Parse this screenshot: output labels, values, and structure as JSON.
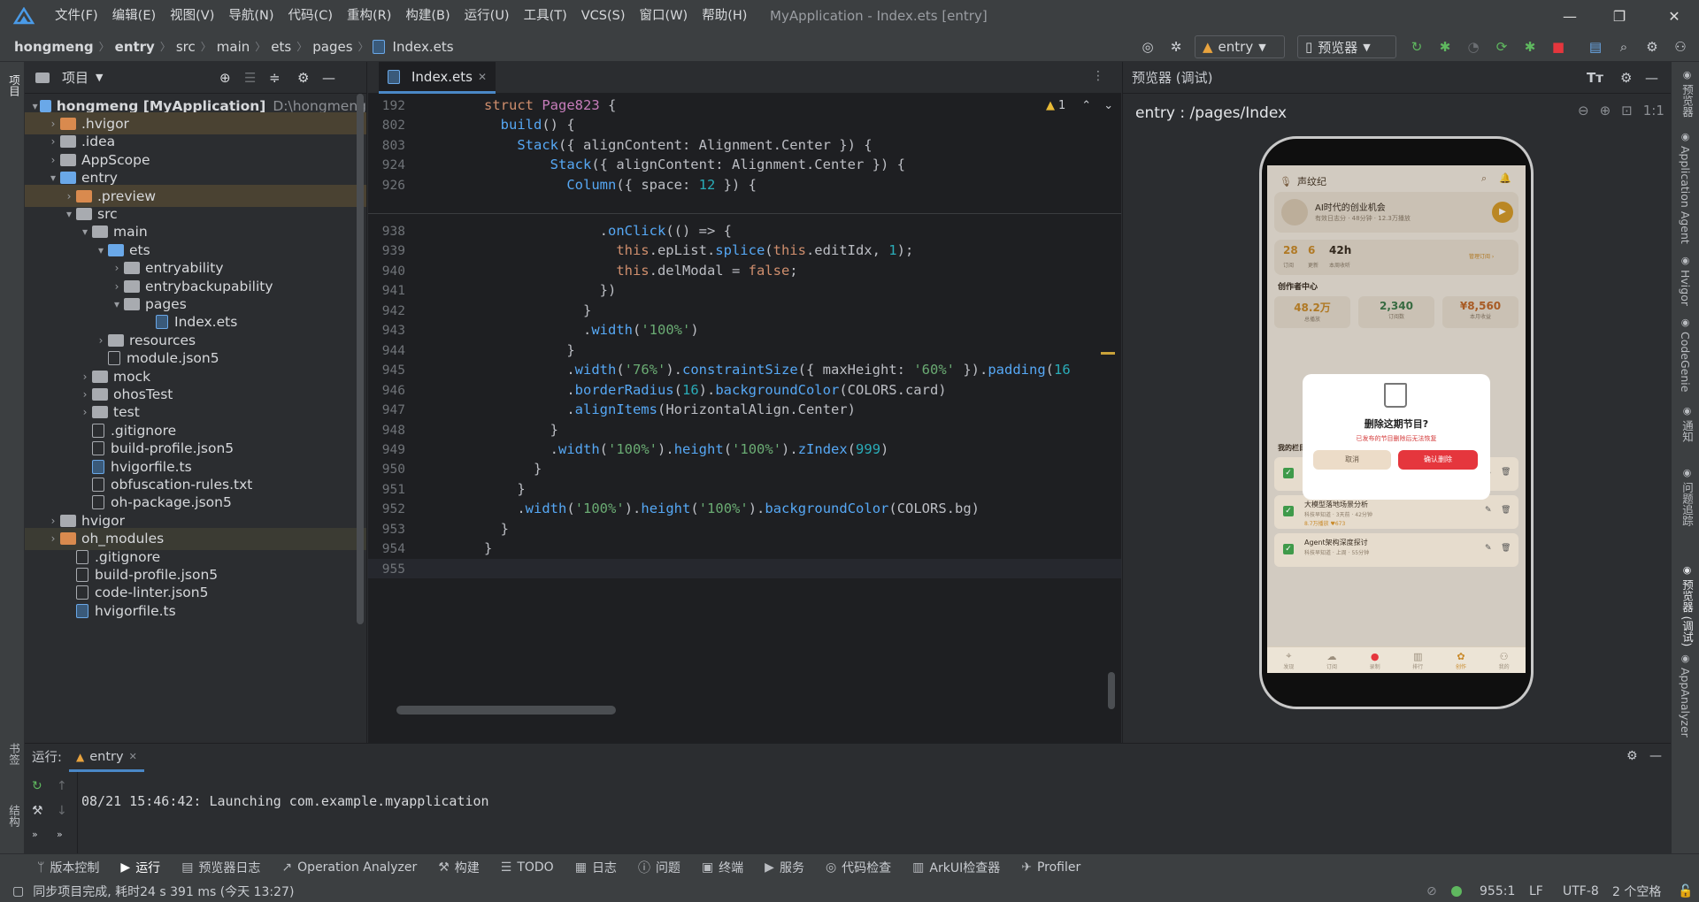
{
  "menu": [
    "文件(F)",
    "编辑(E)",
    "视图(V)",
    "导航(N)",
    "代码(C)",
    "重构(R)",
    "构建(B)",
    "运行(U)",
    "工具(T)",
    "VCS(S)",
    "窗口(W)",
    "帮助(H)"
  ],
  "window_title": "MyApplication - Index.ets [entry]",
  "breadcrumbs": [
    "hongmeng",
    "entry",
    "src",
    "main",
    "ets",
    "pages",
    "Index.ets"
  ],
  "toolbar": {
    "run_config": "entry",
    "device": "预览器"
  },
  "project": {
    "title": "项目",
    "tree": [
      {
        "label": "hongmeng [MyApplication]",
        "extra": "D:\\hongmeng"
      },
      {
        "label": ".hvigor"
      },
      {
        "label": ".idea"
      },
      {
        "label": "AppScope"
      },
      {
        "label": "entry"
      },
      {
        "label": ".preview"
      },
      {
        "label": "src"
      },
      {
        "label": "main"
      },
      {
        "label": "ets"
      },
      {
        "label": "entryability"
      },
      {
        "label": "entrybackupability"
      },
      {
        "label": "pages"
      },
      {
        "label": "Index.ets"
      },
      {
        "label": "resources"
      },
      {
        "label": "module.json5"
      },
      {
        "label": "mock"
      },
      {
        "label": "ohosTest"
      },
      {
        "label": "test"
      },
      {
        "label": ".gitignore"
      },
      {
        "label": "build-profile.json5"
      },
      {
        "label": "hvigorfile.ts"
      },
      {
        "label": "obfuscation-rules.txt"
      },
      {
        "label": "oh-package.json5"
      },
      {
        "label": "hvigor"
      },
      {
        "label": "oh_modules"
      },
      {
        "label": ".gitignore"
      },
      {
        "label": "build-profile.json5"
      },
      {
        "label": "code-linter.json5"
      },
      {
        "label": "hvigorfile.ts"
      }
    ]
  },
  "editor": {
    "tab": "Index.ets",
    "warning_count": "1",
    "sticky_lines": [
      "192",
      "802",
      "803",
      "924",
      "926"
    ],
    "lines": [
      "938",
      "939",
      "940",
      "941",
      "942",
      "943",
      "944",
      "945",
      "946",
      "947",
      "948",
      "949",
      "950",
      "951",
      "952",
      "953",
      "954",
      "955"
    ]
  },
  "preview": {
    "title": "预览器 (调试)",
    "path": "entry : /pages/Index",
    "app": {
      "brand": "声纹纪",
      "now_playing": "AI时代的创业机会",
      "now_sub": "有效日志分 · 48分钟 · 12.3万播放",
      "stats": [
        {
          "v": "28",
          "l": "订阅"
        },
        {
          "v": "6",
          "l": "更新"
        },
        {
          "v": "42h",
          "l": "本周收听"
        }
      ],
      "stats_link": "管理订阅 ›",
      "creator_title": "创作者中心",
      "creator": [
        {
          "v": "48.2万",
          "l": "总播放"
        },
        {
          "v": "2,340",
          "l": "订阅数"
        },
        {
          "v": "¥8,560",
          "l": "本月收益"
        }
      ],
      "modal_title": "删除这期节目?",
      "modal_sub": "已发布的节目删除后无法恢复",
      "modal_cancel": "取消",
      "modal_confirm": "确认删除",
      "manage_title": "我的栏目管理",
      "episodes": [
        {
          "t": "AI时代的创业机会",
          "s": "科技早知道 · 今天 · 48分钟",
          "m": "12.3万播放 ♥892"
        },
        {
          "t": "大模型落地场景分析",
          "s": "科技早知道 · 3天前 · 42分钟",
          "m": "8.7万播放 ♥673"
        },
        {
          "t": "Agent架构深度探讨",
          "s": "科技早知道 · 上周 · 55分钟",
          "m": ""
        }
      ],
      "tabs": [
        "发现",
        "订阅",
        "录制",
        "排行",
        "创作",
        "我的"
      ]
    }
  },
  "run": {
    "label": "运行:",
    "tab": "entry",
    "log": "08/21 15:46:42: Launching com.example.myapplication"
  },
  "toolwindows": [
    "版本控制",
    "运行",
    "预览器日志",
    "Operation Analyzer",
    "构建",
    "TODO",
    "日志",
    "问题",
    "终端",
    "服务",
    "代码检查",
    "ArkUI检查器",
    "Profiler"
  ],
  "left_tabs": {
    "project": "项目",
    "bookmarks": "书签",
    "structure": "结构"
  },
  "right_tabs": [
    "预览器",
    "Application Agent",
    "Hvigor",
    "CodeGenie",
    "通知",
    "问题追踪",
    "预览器 (调试)",
    "AppAnalyzer"
  ],
  "status": {
    "message": "同步项目完成, 耗时24 s 391 ms (今天 13:27)",
    "position": "955:1",
    "line_sep": "LF",
    "encoding": "UTF-8",
    "indent": "2 个空格"
  },
  "colors": {
    "accent": "#4a88c7",
    "danger": "#e5363d",
    "app_bg": "#efe8dc"
  }
}
